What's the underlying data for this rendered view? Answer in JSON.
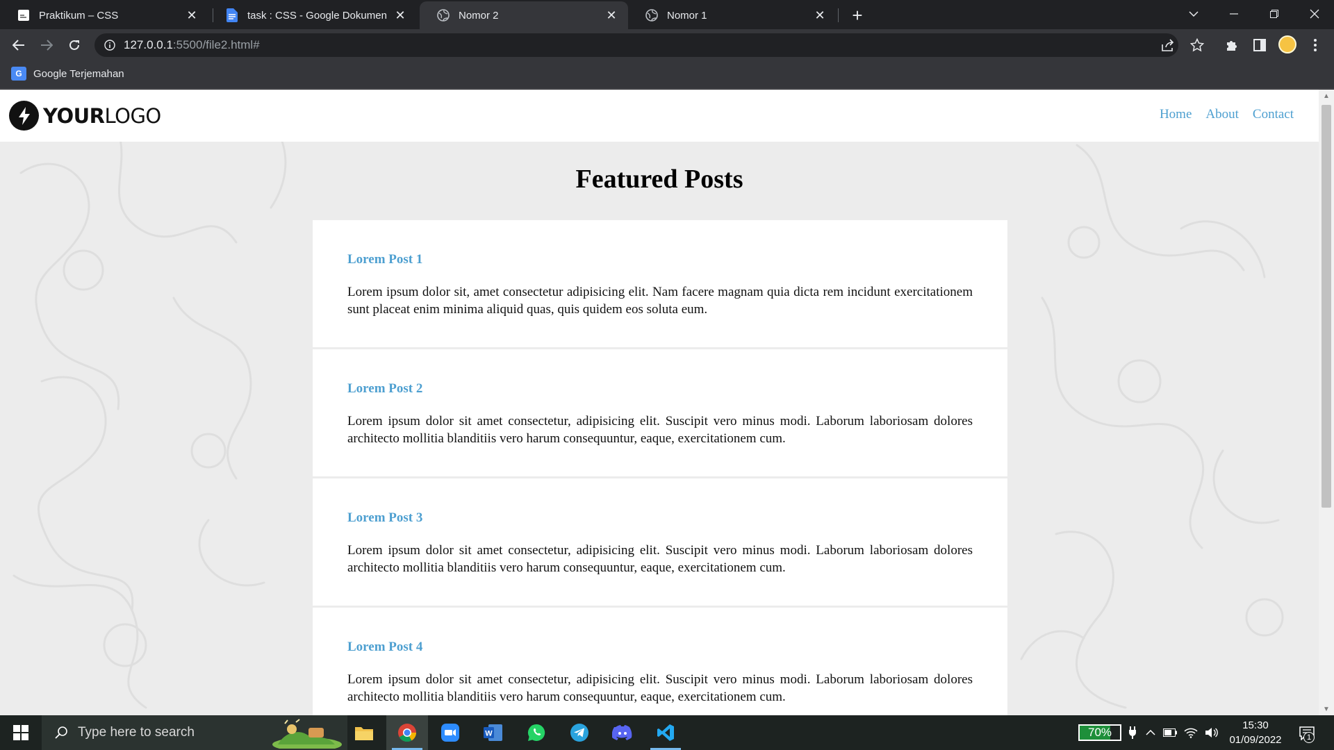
{
  "browser": {
    "tabs": [
      {
        "title": "Praktikum – CSS",
        "favicon": "page-icon",
        "active": false
      },
      {
        "title": "task : CSS - Google Dokumen",
        "favicon": "google-docs-icon",
        "active": false
      },
      {
        "title": "Nomor 2",
        "favicon": "globe-icon",
        "active": true
      },
      {
        "title": "Nomor 1",
        "favicon": "globe-icon",
        "active": false
      }
    ],
    "url_host": "127.0.0.1",
    "url_rest": ":5500/file2.html#",
    "bookmarks": [
      {
        "label": "Google Terjemahan",
        "icon": "google-translate-icon"
      }
    ]
  },
  "site": {
    "logo_bold": "YOUR",
    "logo_light": "LOGO",
    "nav": [
      "Home",
      "About",
      "Contact"
    ],
    "heading": "Featured Posts",
    "posts": [
      {
        "title": "Lorem Post 1",
        "body": "Lorem ipsum dolor sit, amet consectetur adipisicing elit. Nam facere magnam quia dicta rem incidunt exercitationem sunt placeat enim minima aliquid quas, quis quidem eos soluta eum."
      },
      {
        "title": "Lorem Post 2",
        "body": "Lorem ipsum dolor sit amet consectetur, adipisicing elit. Suscipit vero minus modi. Laborum laboriosam dolores architecto mollitia blanditiis vero harum consequuntur, eaque, exercitationem cum."
      },
      {
        "title": "Lorem Post 3",
        "body": "Lorem ipsum dolor sit amet consectetur, adipisicing elit. Suscipit vero minus modi. Laborum laboriosam dolores architecto mollitia blanditiis vero harum consequuntur, eaque, exercitationem cum."
      },
      {
        "title": "Lorem Post 4",
        "body": "Lorem ipsum dolor sit amet consectetur, adipisicing elit. Suscipit vero minus modi. Laborum laboriosam dolores architecto mollitia blanditiis vero harum consequuntur, eaque, exercitationem cum."
      }
    ],
    "colors": {
      "link": "#4d9fd0",
      "background": "#ececec",
      "card": "#ffffff"
    }
  },
  "taskbar": {
    "search_placeholder": "Type here to search",
    "apps": [
      "file-explorer-icon",
      "chrome-icon",
      "zoom-icon",
      "word-icon",
      "whatsapp-icon",
      "telegram-icon",
      "discord-icon",
      "vscode-icon"
    ],
    "battery": "70%",
    "battery_level": 0.7,
    "time": "15:30",
    "date": "01/09/2022",
    "notifications": "1"
  }
}
